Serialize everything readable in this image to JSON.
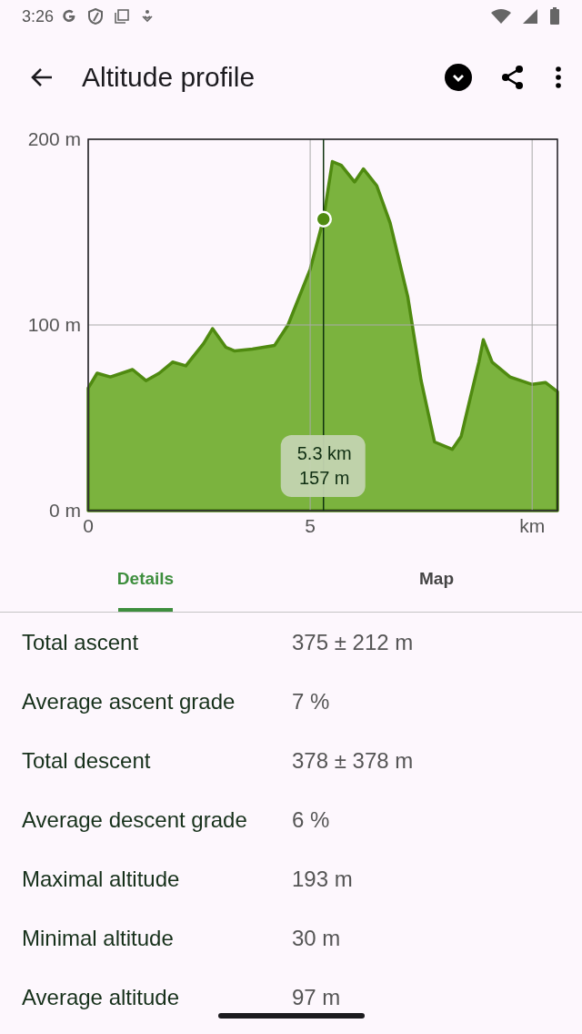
{
  "status_bar": {
    "time": "3:26"
  },
  "toolbar": {
    "title": "Altitude profile"
  },
  "chart": {
    "chart_data": {
      "type": "area",
      "x": [
        0,
        0.2,
        0.5,
        1.0,
        1.3,
        1.6,
        1.9,
        2.2,
        2.6,
        2.8,
        3.1,
        3.3,
        3.7,
        4.2,
        4.5,
        4.8,
        5.0,
        5.3,
        5.5,
        5.7,
        6.0,
        6.2,
        6.5,
        6.8,
        7.2,
        7.5,
        7.8,
        8.2,
        8.4,
        8.6,
        8.8,
        8.9,
        9.1,
        9.5,
        10.0,
        10.3,
        10.57
      ],
      "series": [
        {
          "color": "#7bb33e",
          "values": [
            66,
            74,
            72,
            76,
            70,
            74,
            80,
            78,
            90,
            98,
            88,
            86,
            87,
            89,
            100,
            118,
            130,
            157,
            188,
            186,
            177,
            184,
            175,
            155,
            115,
            70,
            37,
            33,
            40,
            60,
            80,
            92,
            80,
            72,
            68,
            69,
            64
          ]
        }
      ],
      "xlim": [
        0,
        10.57
      ],
      "ylim": [
        0,
        200
      ],
      "grid": true,
      "xticks": [
        0,
        5,
        {
          "value": 10,
          "label": "km"
        }
      ],
      "yticks": [
        {
          "value": 0,
          "label": "0 m"
        },
        {
          "value": 100,
          "label": "100 m"
        },
        {
          "value": 200,
          "label": "200 m"
        }
      ],
      "ref_lines": [
        {
          "axis": "x",
          "value": 5.3
        }
      ],
      "annotations": [
        {
          "text": "5.3 km\n157 m",
          "x": 5.3,
          "y": 24
        }
      ]
    }
  },
  "tabs": [
    {
      "label": "Details",
      "selected": true
    },
    {
      "label": "Map",
      "selected": false
    }
  ],
  "details": [
    {
      "label": "Total ascent",
      "value": "375 ± 212 m"
    },
    {
      "label": "Average ascent grade",
      "value": "7 %"
    },
    {
      "label": "Total descent",
      "value": "378 ± 378 m"
    },
    {
      "label": "Average descent grade",
      "value": "6 %"
    },
    {
      "label": "Maximal altitude",
      "value": "193 m"
    },
    {
      "label": "Minimal altitude",
      "value": "30 m"
    },
    {
      "label": "Average altitude",
      "value": "97 m"
    }
  ]
}
